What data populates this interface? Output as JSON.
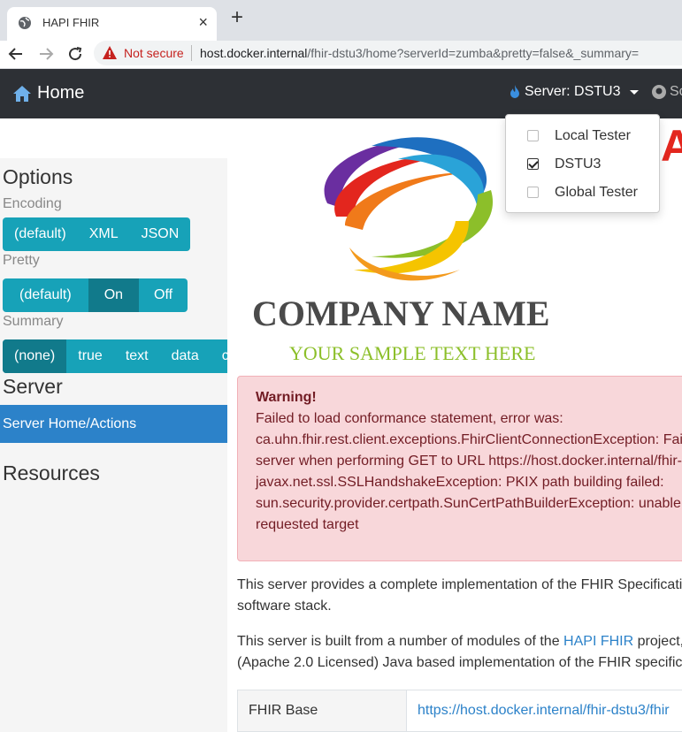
{
  "browser": {
    "tab_title": "HAPI FHIR",
    "close_glyph": "×",
    "new_tab_glyph": "+",
    "not_secure": "Not secure",
    "url_host": "host.docker.internal",
    "url_path": "/fhir-dstu3/home?serverId=zumba&pretty=false&_summary="
  },
  "navbar": {
    "home_label": "Home",
    "server_label": "Server: DSTU3",
    "github_label": "So"
  },
  "server_dropdown": {
    "items": [
      {
        "label": "Local Tester",
        "checked": false
      },
      {
        "label": "DSTU3",
        "checked": true
      },
      {
        "label": "Global Tester",
        "checked": false
      }
    ]
  },
  "sidebar": {
    "options_heading": "Options",
    "encoding_label": "Encoding",
    "encoding_buttons": [
      "(default)",
      "XML",
      "JSON"
    ],
    "pretty_label": "Pretty",
    "pretty_buttons": [
      "(default)",
      "On",
      "Off"
    ],
    "pretty_selected": "On",
    "summary_label": "Summary",
    "summary_buttons": [
      "(none)",
      "true",
      "text",
      "data",
      "co"
    ],
    "summary_selected": "(none)",
    "server_heading": "Server",
    "server_home": "Server Home/Actions",
    "resources_heading": "Resources"
  },
  "logo": {
    "company": "COMPANY NAME",
    "tagline": "YOUR SAMPLE TEXT HERE",
    "colors": {
      "purple": "#6a2ea0",
      "blue": "#1e6fc0",
      "green": "#8cbf2a",
      "yellow": "#f5c400",
      "orange": "#f07a1a",
      "red": "#e3261e"
    },
    "partial_letter": "A"
  },
  "alert": {
    "title": "Warning!",
    "lines": [
      "Failed to load conformance statement, error was:",
      "ca.uhn.fhir.rest.client.exceptions.FhirClientConnectionException: Fai",
      "server when performing GET to URL https://host.docker.internal/fhir-",
      "javax.net.ssl.SSLHandshakeException: PKIX path building failed:",
      "sun.security.provider.certpath.SunCertPathBuilderException: unable",
      "requested target"
    ]
  },
  "content": {
    "p1_line1": "This server provides a complete implementation of the FHIR Specificati",
    "p1_line2": "software stack.",
    "p2_line1_a": "This server is built from a number of modules of the ",
    "p2_link": "HAPI FHIR",
    "p2_line1_b": " project,",
    "p2_line2": "(Apache 2.0 Licensed) Java based implementation of the FHIR specific"
  },
  "table": {
    "key": "FHIR Base",
    "value": "https://host.docker.internal/fhir-dstu3/fhir"
  }
}
